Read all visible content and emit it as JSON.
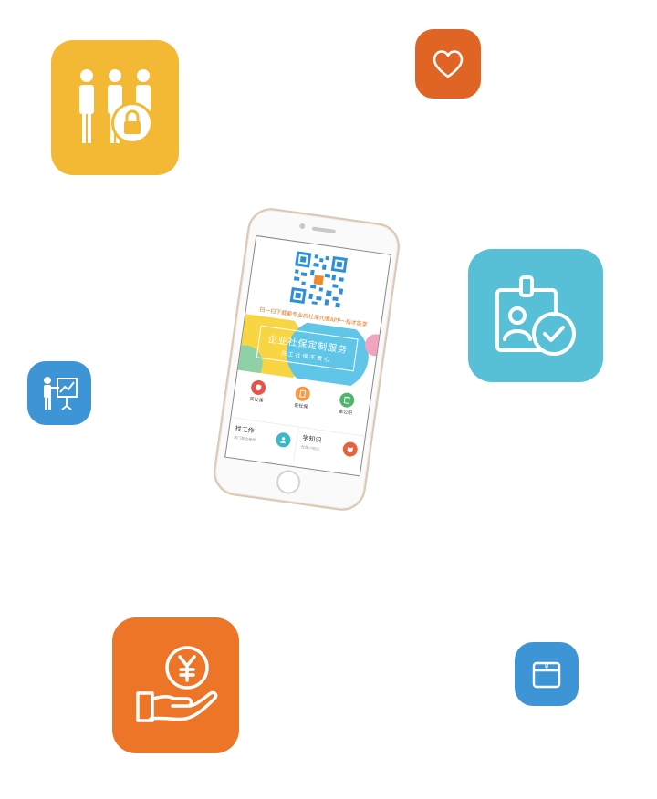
{
  "icons": {
    "users_lock": "users-lock-icon",
    "heart": "heart-icon",
    "id_badge_check": "id-badge-check-icon",
    "presentation": "presentation-icon",
    "money_hand": "yuan-hand-icon",
    "wallet": "yuan-wallet-icon"
  },
  "colors": {
    "yellow": "#F3B935",
    "orange_dark": "#E06525",
    "teal": "#58C0D6",
    "blue": "#3D95D6",
    "orange": "#EC7527"
  },
  "phone": {
    "scan_text": "扫一扫下载最专业的社保代缴APP一指才能享",
    "banner_title": "企业社保定制服务",
    "banner_sub": "员工社保不费心",
    "services": [
      {
        "label": "买社保",
        "color": "#E8524A",
        "icon": "shield-icon"
      },
      {
        "label": "查社保",
        "color": "#F29A4A",
        "icon": "document-icon"
      },
      {
        "label": "拿公积",
        "color": "#4CB66A",
        "icon": "clipboard-icon"
      }
    ],
    "cards": [
      {
        "title": "找工作",
        "sub": "热门职位推荐",
        "color": "#3FB7C6"
      },
      {
        "title": "学知识",
        "sub": "社保小知识",
        "color": "#E8613A"
      }
    ]
  }
}
